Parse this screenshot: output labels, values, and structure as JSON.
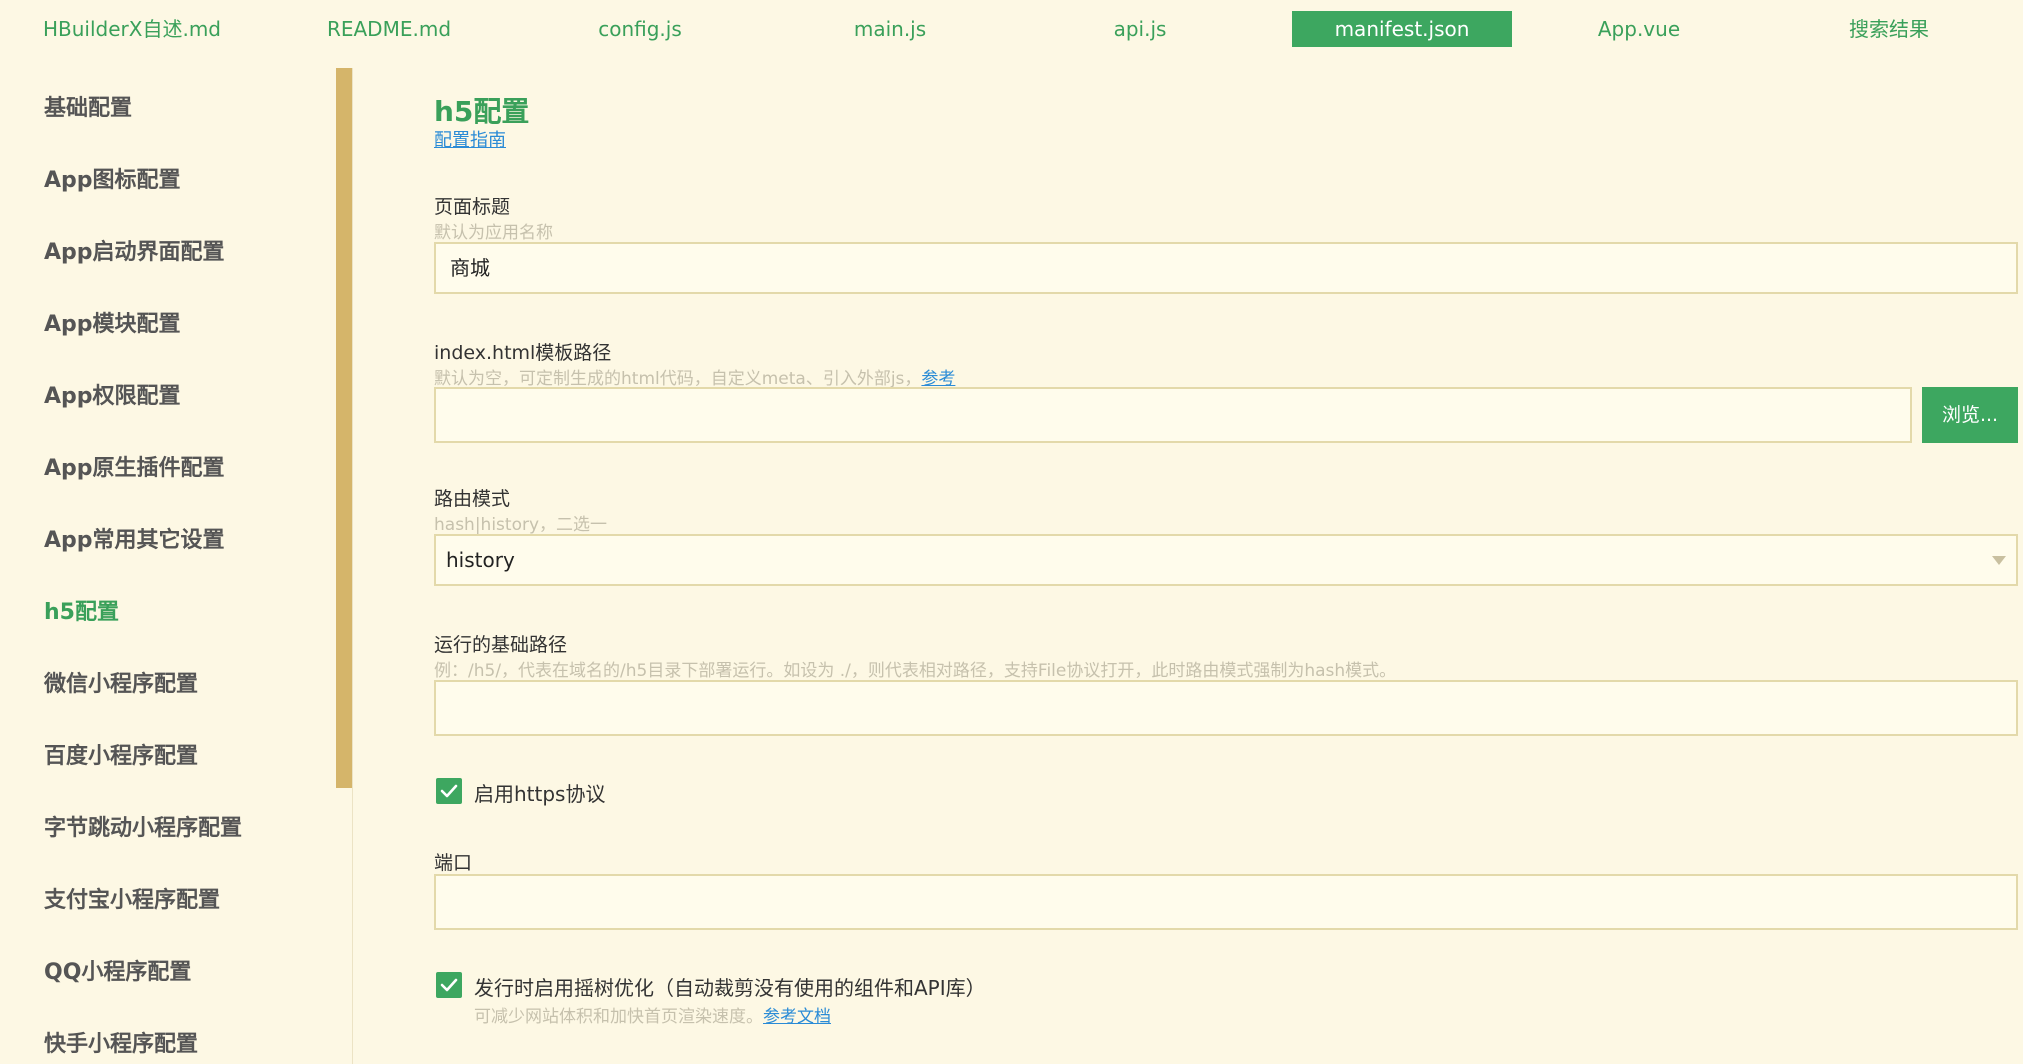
{
  "tabs": [
    {
      "label": "HBuilderX自述.md",
      "active": false
    },
    {
      "label": "README.md",
      "active": false
    },
    {
      "label": "config.js",
      "active": false
    },
    {
      "label": "main.js",
      "active": false
    },
    {
      "label": "api.js",
      "active": false
    },
    {
      "label": "manifest.json",
      "active": true
    },
    {
      "label": "App.vue",
      "active": false
    },
    {
      "label": "搜索结果",
      "active": false
    }
  ],
  "sidebar": {
    "items": [
      {
        "label": "基础配置"
      },
      {
        "label": "App图标配置"
      },
      {
        "label": "App启动界面配置"
      },
      {
        "label": "App模块配置"
      },
      {
        "label": "App权限配置"
      },
      {
        "label": "App原生插件配置"
      },
      {
        "label": "App常用其它设置"
      },
      {
        "label": "h5配置",
        "active": true
      },
      {
        "label": "微信小程序配置"
      },
      {
        "label": "百度小程序配置"
      },
      {
        "label": "字节跳动小程序配置"
      },
      {
        "label": "支付宝小程序配置"
      },
      {
        "label": "QQ小程序配置"
      },
      {
        "label": "快手小程序配置"
      }
    ]
  },
  "main": {
    "title": "h5配置",
    "guide_link": "配置指南",
    "page_title_field": {
      "label": "页面标题",
      "hint": "默认为应用名称",
      "value": "商城"
    },
    "template_field": {
      "label": "index.html模板路径",
      "hint": "默认为空，可定制生成的html代码，自定义meta、引入外部js，",
      "hint_link": "参考",
      "value": "",
      "browse_label": "浏览..."
    },
    "router_field": {
      "label": "路由模式",
      "hint": "hash|history，二选一",
      "value": "history"
    },
    "base_path_field": {
      "label": "运行的基础路径",
      "hint": "例：/h5/，代表在域名的/h5目录下部署运行。如设为 ./，则代表相对路径，支持File协议打开，此时路由模式强制为hash模式。",
      "value": ""
    },
    "https_checkbox": {
      "label": "启用https协议",
      "checked": true
    },
    "port_field": {
      "label": "端口",
      "value": ""
    },
    "treeshake_checkbox": {
      "label": "发行时启用摇树优化（自动裁剪没有使用的组件和API库）",
      "hint": "可减少网站体积和加快首页渲染速度。",
      "hint_link": "参考文档",
      "checked": true
    }
  },
  "colors": {
    "accent": "#3da760",
    "background": "#fdf8e4",
    "scrollbar": "#d5b56a",
    "link": "#2a8bd6"
  }
}
